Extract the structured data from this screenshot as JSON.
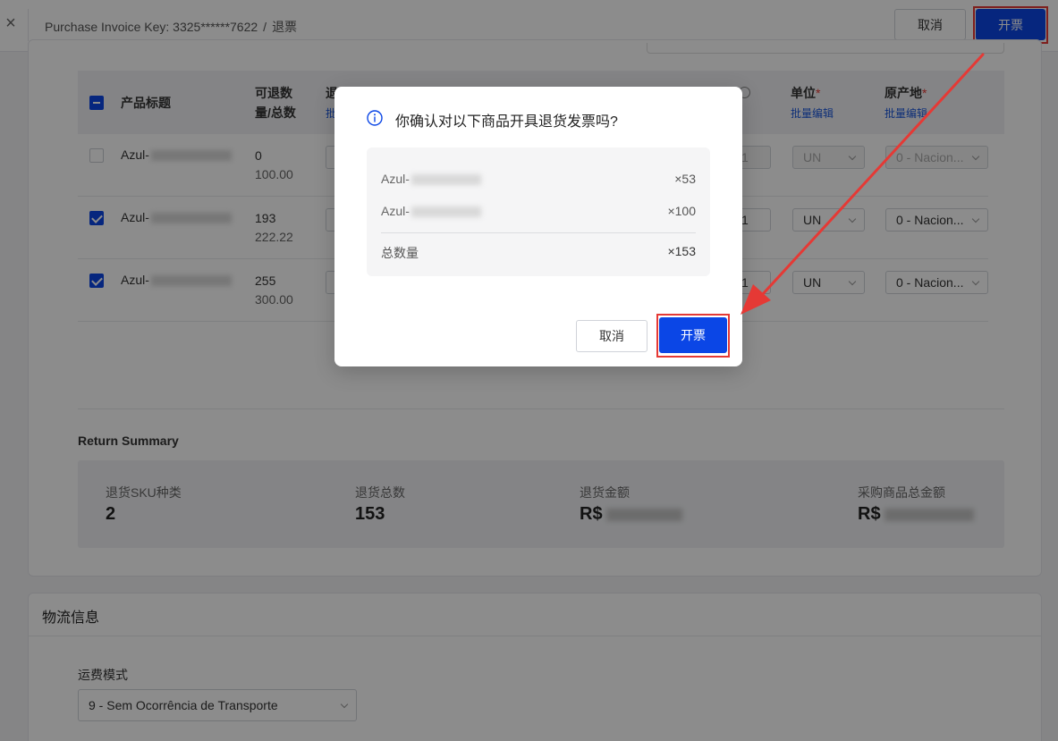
{
  "header": {
    "close_glyph": "×",
    "breadcrumb_key": "Purchase Invoice Key: 3325******7622",
    "breadcrumb_sep": "/",
    "breadcrumb_page": "退票",
    "cancel_label": "取消",
    "issue_label": "开票"
  },
  "table": {
    "col_product": "产品标题",
    "col_returnable_line1": "可退数",
    "col_returnable_line2": "量/总数",
    "col_return_cut": "退",
    "col_batch_cut": "批",
    "col_unit": "单位",
    "col_origin": "原产地",
    "required_mark": "*",
    "batch_edit": "批量编辑",
    "rows": [
      {
        "product": "Azul-",
        "returnable": "0",
        "total": "100.00",
        "checked": false,
        "qty_cut": "1",
        "unit": "UN",
        "origin": "0 - Nacion..."
      },
      {
        "product": "Azul-",
        "returnable": "193",
        "total": "222.22",
        "checked": true,
        "qty_cut": "1",
        "unit": "UN",
        "origin": "0 - Nacion..."
      },
      {
        "product": "Azul-",
        "returnable": "255",
        "total": "300.00",
        "checked": true,
        "qty_cut": "1",
        "unit": "UN",
        "origin": "0 - Nacion..."
      }
    ]
  },
  "summary": {
    "title": "Return Summary",
    "sku_label": "退货SKU种类",
    "sku_value": "2",
    "qty_label": "退货总数",
    "qty_value": "153",
    "amount_label": "退货金额",
    "amount_prefix": "R$",
    "purchase_label": "采购商品总金额",
    "purchase_prefix": "R$"
  },
  "logistics": {
    "title": "物流信息",
    "freight_label": "运费模式",
    "freight_value": "9 - Sem Ocorrência de Transporte"
  },
  "modal": {
    "title": "你确认对以下商品开具退货发票吗?",
    "items": [
      {
        "name": "Azul-",
        "qty": "×53"
      },
      {
        "name": "Azul-",
        "qty": "×100"
      }
    ],
    "total_label": "总数量",
    "total_qty": "×153",
    "cancel_label": "取消",
    "confirm_label": "开票"
  },
  "colors": {
    "primary": "#0b46e6",
    "highlight": "#e53935"
  }
}
